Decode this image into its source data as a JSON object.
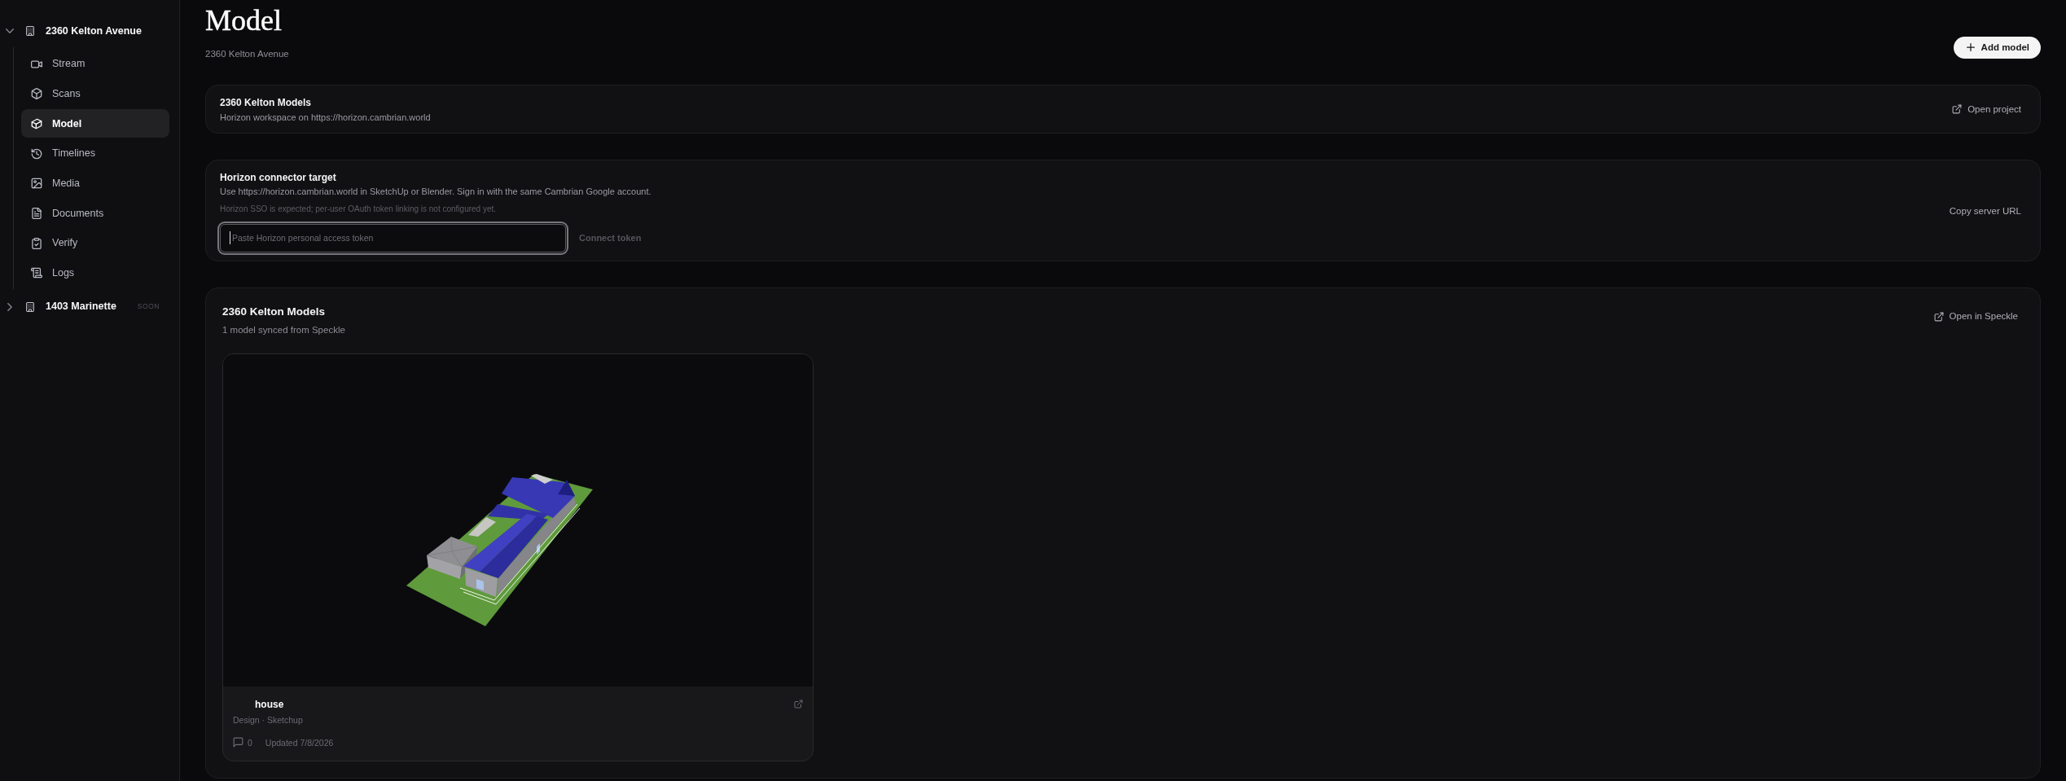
{
  "sidebar": {
    "properties": [
      {
        "name": "2360 Kelton Avenue",
        "expanded": true,
        "items": [
          {
            "label": "Stream",
            "selected": false
          },
          {
            "label": "Scans",
            "selected": false
          },
          {
            "label": "Model",
            "selected": true
          },
          {
            "label": "Timelines",
            "selected": false
          },
          {
            "label": "Media",
            "selected": false
          },
          {
            "label": "Documents",
            "selected": false
          },
          {
            "label": "Verify",
            "selected": false
          },
          {
            "label": "Logs",
            "selected": false
          }
        ]
      },
      {
        "name": "1403 Marinette",
        "expanded": false,
        "badge": "SOON"
      }
    ]
  },
  "header": {
    "title": "Model",
    "subtitle": "2360 Kelton Avenue",
    "add_button": "Add model"
  },
  "project_card": {
    "title": "2360 Kelton Models",
    "description": "Horizon workspace on https://horizon.cambrian.world",
    "action": "Open project"
  },
  "connector_card": {
    "title": "Horizon connector target",
    "description": "Use https://horizon.cambrian.world in SketchUp or Blender. Sign in with the same Cambrian Google account.",
    "note": "Horizon SSO is expected; per-user OAuth token linking is not configured yet.",
    "token_field": {
      "placeholder": "Paste Horizon personal access token",
      "focused": true
    },
    "connect_button": {
      "label": "Connect token",
      "disabled": true
    },
    "copy_button": "Copy server URL"
  },
  "models_section": {
    "title": "2360 Kelton Models",
    "subtitle": "1 model synced from Speckle",
    "action": "Open in Speckle",
    "models": [
      {
        "name": "house",
        "details": "Design · Sketchup",
        "comments": "0",
        "updated": "Updated 7/8/2026"
      }
    ]
  }
}
